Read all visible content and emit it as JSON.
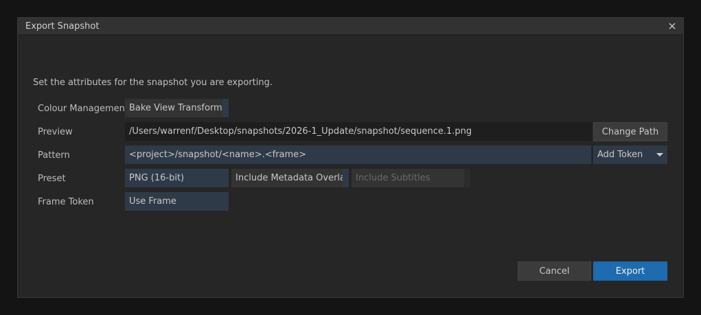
{
  "dialog": {
    "title": "Export Snapshot",
    "description": "Set the attributes for the snapshot you are exporting."
  },
  "rows": {
    "colour_management": {
      "label": "Colour Management",
      "value": "Bake View Transform"
    },
    "preview": {
      "label": "Preview",
      "value": "/Users/warrenf/Desktop/snapshots/2026-1_Update/snapshot/sequence.1.png",
      "button": "Change Path"
    },
    "pattern": {
      "label": "Pattern",
      "value": "<project>/snapshot/<name>.<frame>",
      "button": "Add Token"
    },
    "preset": {
      "label": "Preset",
      "value": "PNG (16-bit)",
      "metadata_toggle": "Include Metadata Overlay",
      "subtitles_toggle": "Include Subtitles"
    },
    "frame_token": {
      "label": "Frame Token",
      "value": "Use Frame"
    }
  },
  "footer": {
    "cancel": "Cancel",
    "export": "Export"
  },
  "colors": {
    "accent": "#1e6bb0",
    "field_blue": "#2f3a49"
  }
}
